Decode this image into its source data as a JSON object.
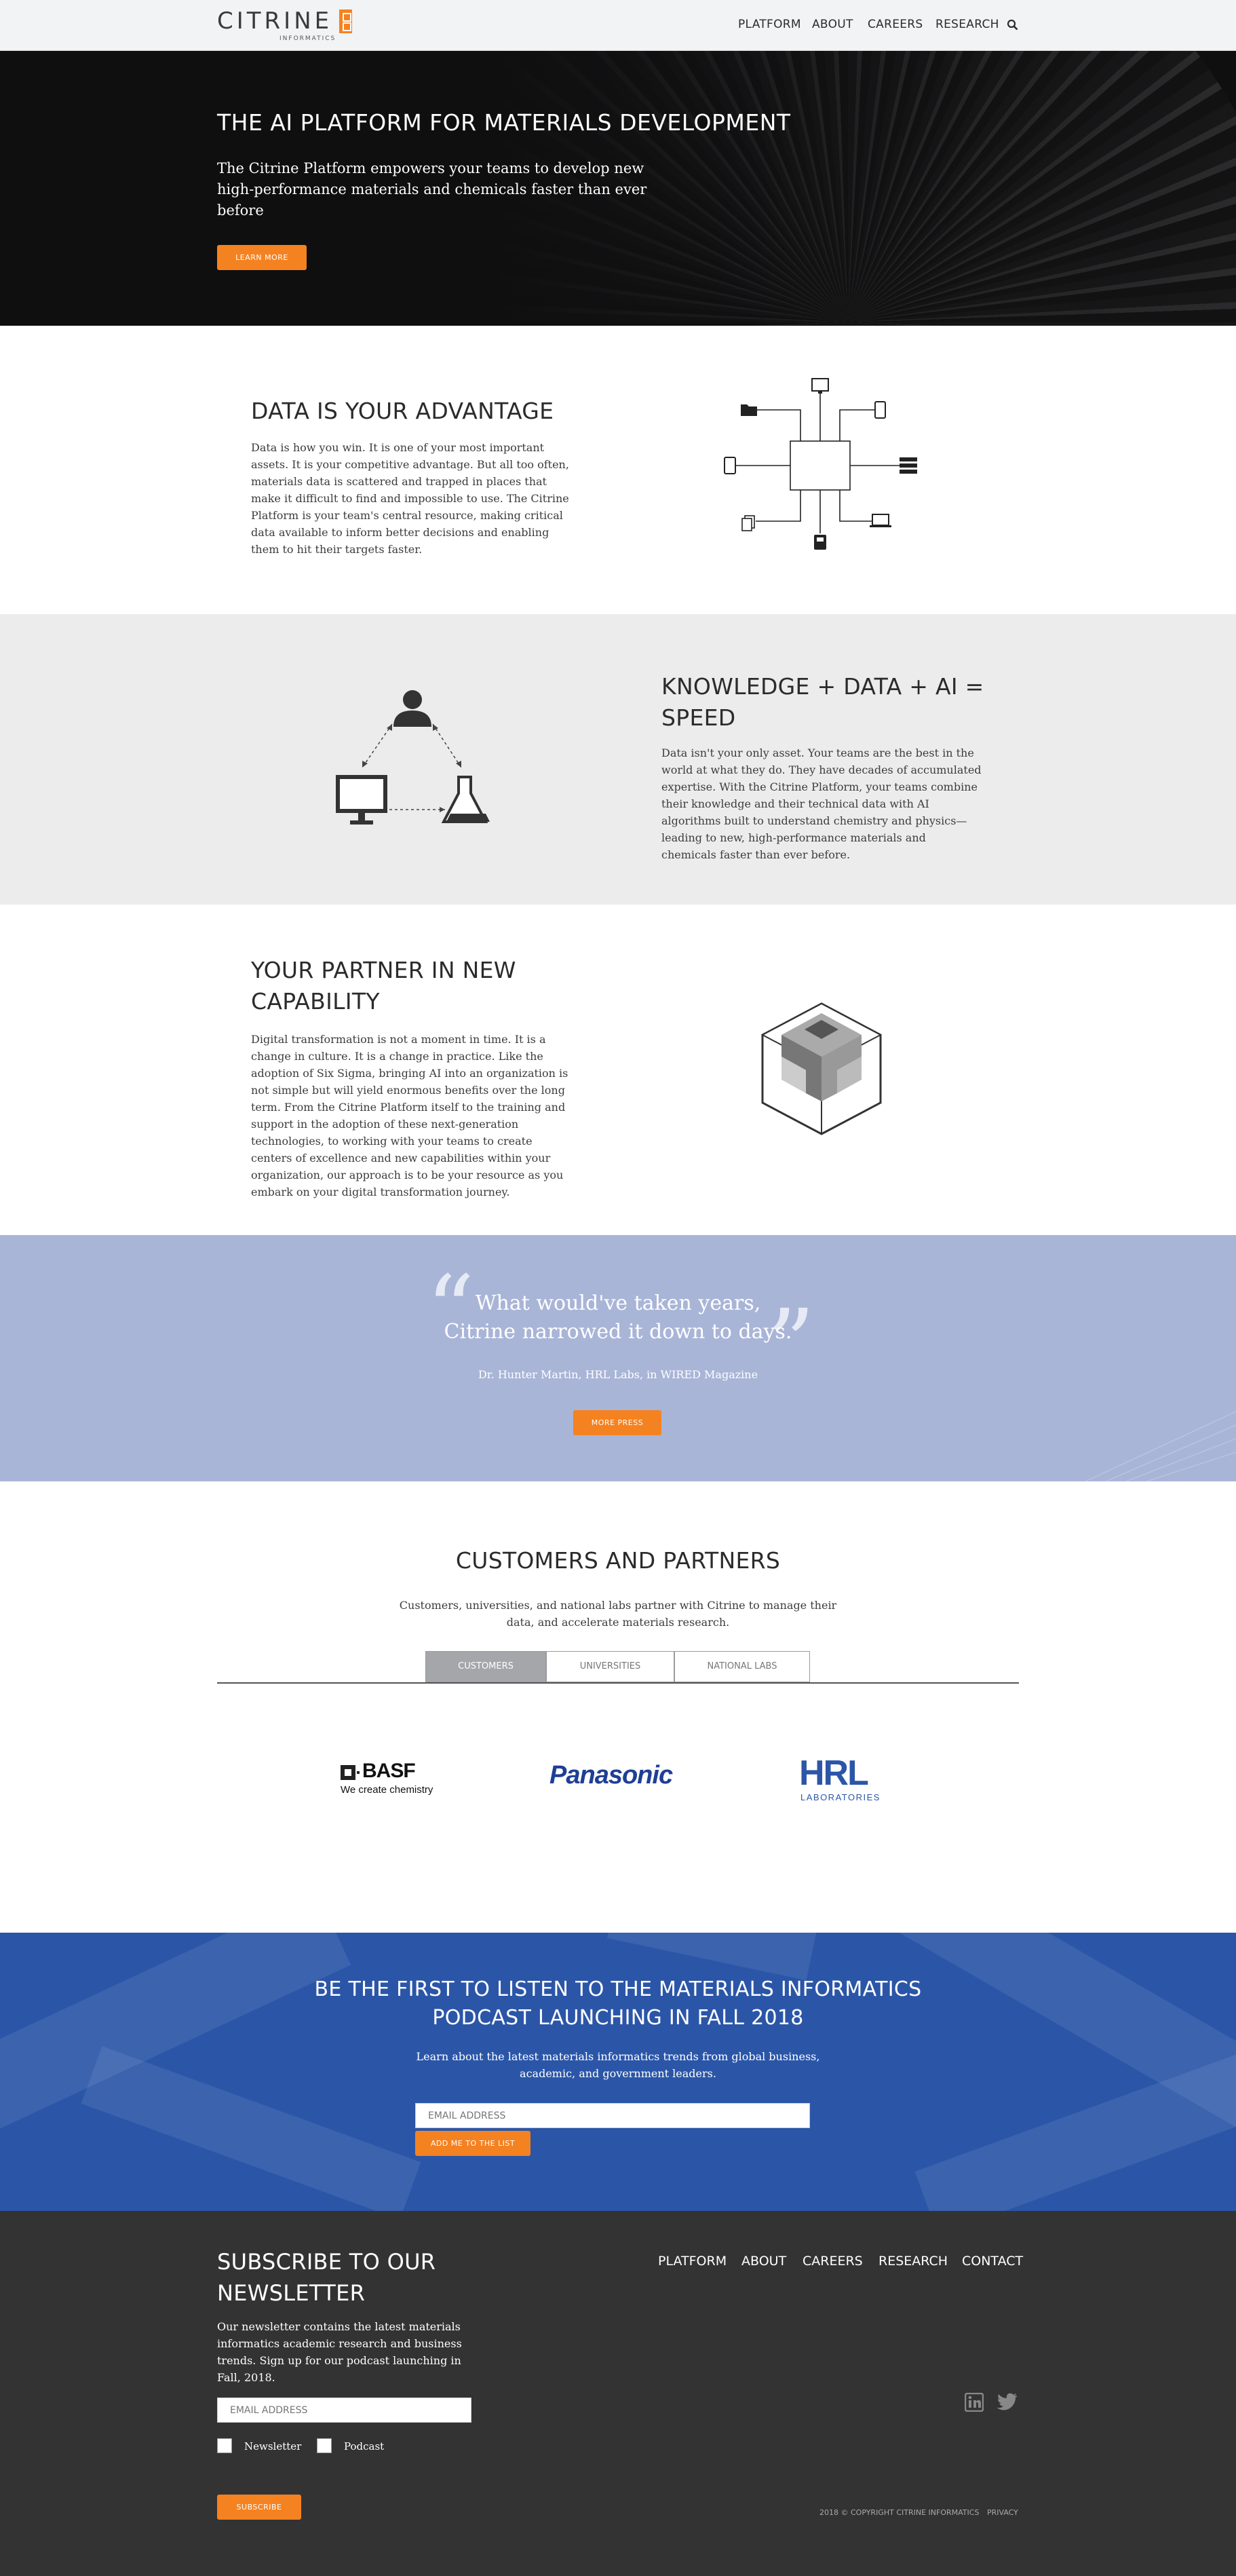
{
  "nav": {
    "logo_text": "CITRINE",
    "logo_sub": "INFORMATICS",
    "links": [
      "PLATFORM",
      "ABOUT",
      "CAREERS",
      "RESEARCH"
    ],
    "search_icon": "search-icon"
  },
  "hero": {
    "title": "THE AI PLATFORM FOR MATERIALS DEVELOPMENT",
    "text": "The Citrine Platform empowers your teams to develop new high-performance materials and chemicals faster than ever before",
    "button": "LEARN MORE"
  },
  "advantage": {
    "title": "DATA IS YOUR ADVANTAGE",
    "text": "Data is how you win. It is one of your most important assets. It is your competitive advantage. But all too often, materials data is scattered and trapped in places that make it difficult to find and impossible to use. The Citrine Platform is your team's central resource, making critical data available to inform better decisions and enabling them to hit their targets faster."
  },
  "speed": {
    "title": "KNOWLEDGE + DATA + AI = SPEED",
    "text": "Data isn't your only asset. Your teams are the best in the world at what they do. They have decades of accumulated expertise. With the Citrine Platform, your teams combine their knowledge and their technical data with AI algorithms built to understand chemistry and physics—leading to new, high-performance materials and chemicals faster than ever before."
  },
  "partner": {
    "title": "YOUR PARTNER IN NEW CAPABILITY",
    "text": "Digital transformation is not a moment in time. It is a change in culture. It is a change in practice. Like the adoption of Six Sigma, bringing AI into an organization is not simple but will yield enormous benefits over the long term. From the Citrine Platform itself to the training and support in the adoption of these next-generation technologies, to working with your teams to create centers of excellence and new capabilities within your organization, our approach is to be your resource as you embark on your digital transformation journey."
  },
  "quote": {
    "line1": "What would've taken years,",
    "line2": "Citrine narrowed it down to days.",
    "attribution": "Dr. Hunter Martin, HRL Labs, in WIRED Magazine",
    "button": "MORE PRESS"
  },
  "customers": {
    "title": "CUSTOMERS AND PARTNERS",
    "text": "Customers, universities, and national labs partner with Citrine to manage their data, and accelerate materials research.",
    "tabs": [
      "CUSTOMERS",
      "UNIVERSITIES",
      "NATIONAL LABS"
    ],
    "logos": {
      "basf": "BASF",
      "basf_tagline": "We create chemistry",
      "panasonic": "Panasonic",
      "hrl": "HRL",
      "hrl_sub": "LABORATORIES"
    }
  },
  "podcast": {
    "title": "BE THE FIRST TO LISTEN TO THE MATERIALS INFORMATICS PODCAST LAUNCHING IN FALL 2018",
    "text": "Learn about the latest materials informatics trends from global business, academic, and government leaders.",
    "placeholder": "EMAIL ADDRESS",
    "button": "ADD ME TO THE LIST"
  },
  "footer": {
    "title": "SUBSCRIBE TO OUR NEWSLETTER",
    "text": "Our newsletter contains the latest materials informatics academic research and business trends. Sign up for our podcast launching in Fall, 2018.",
    "placeholder": "EMAIL ADDRESS",
    "checkbox_newsletter": "Newsletter",
    "checkbox_podcast": "Podcast",
    "button": "SUBSCRIBE",
    "links": [
      "PLATFORM",
      "ABOUT",
      "CAREERS",
      "RESEARCH",
      "CONTACT"
    ],
    "copyright": "2018 © COPYRIGHT CITRINE INFORMATICS",
    "privacy": "PRIVACY",
    "social": [
      "linkedin-icon",
      "twitter-icon"
    ]
  },
  "colors": {
    "accent": "#f58220",
    "quote_bg": "#a9b5d7",
    "podcast_bg": "#2b56a8",
    "footer_bg": "#333333",
    "hero_bg": "#0f0f10"
  }
}
